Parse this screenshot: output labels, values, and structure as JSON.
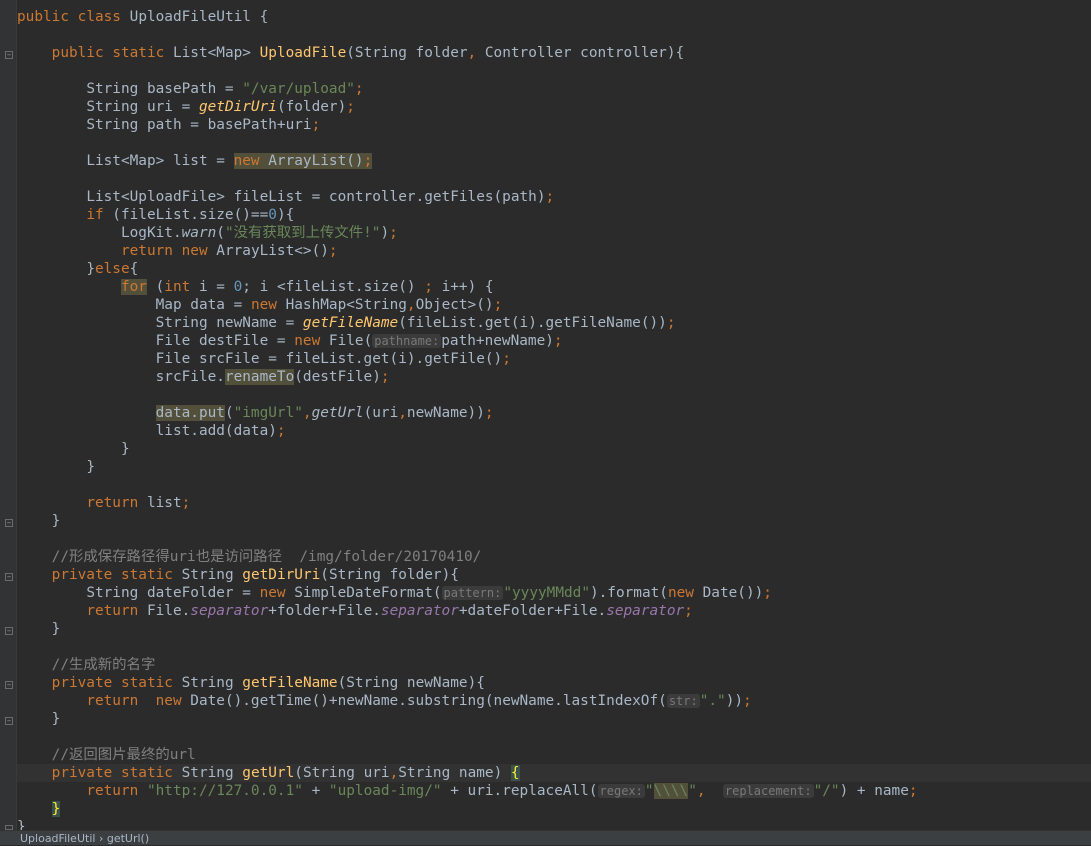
{
  "statusbar": {
    "class_crumb": "UploadFileUtil",
    "sep": "›",
    "method_crumb": "getUrl()"
  },
  "code": {
    "l1": [
      "public",
      "class",
      "UploadFileUtil {"
    ],
    "l3": [
      "public",
      "static",
      "List<Map> ",
      "UploadFile",
      "(String folder",
      ",",
      " Controller controller){"
    ],
    "l5": [
      "String basePath = ",
      "\"/var/upload\"",
      ";"
    ],
    "l6": [
      "String uri = ",
      "getDirUri",
      "(folder)",
      ";"
    ],
    "l7": [
      "String path = basePath+uri",
      ";"
    ],
    "l9": [
      "List<Map> list = ",
      "new",
      " ArrayList()",
      ";"
    ],
    "l11": [
      "List<UploadFile> fileList = controller.getFiles(path)",
      ";"
    ],
    "l12": [
      "if",
      " (fileList.size()==",
      "0",
      "){"
    ],
    "l13": [
      "LogKit.",
      "warn",
      "(",
      "\"没有获取到上传文件!\"",
      ")",
      ";"
    ],
    "l14": [
      "return",
      "new",
      " ArrayList<>()",
      ";"
    ],
    "l15": [
      "}",
      "else",
      "{"
    ],
    "l16": [
      "for",
      " (",
      "int",
      " i = ",
      "0",
      "; i <fileList.size() ",
      "; ",
      "i++) {"
    ],
    "l17": [
      "Map data = ",
      "new",
      " HashMap<String",
      ",",
      "Object>()",
      ";"
    ],
    "l18": [
      "String newName = ",
      "getFileName",
      "(fileList.get(i).getFileName())",
      ";"
    ],
    "l19": [
      "File destFile = ",
      "new",
      " File(",
      "pathname:",
      "path+newName)",
      ";"
    ],
    "l20": [
      "File srcFile = fileList.get(i).getFile()",
      ";"
    ],
    "l21": [
      "srcFile.",
      "renameTo",
      "(destFile)",
      ";"
    ],
    "l23": [
      "data.put",
      "(",
      "\"imgUrl\"",
      ",",
      "getUrl",
      "(uri",
      ",",
      "newName))",
      ";"
    ],
    "l24": [
      "list.add(data)",
      ";"
    ],
    "l25": [
      "}"
    ],
    "l26": [
      "}"
    ],
    "l28": [
      "return",
      " list",
      ";"
    ],
    "l29": [
      "}"
    ],
    "l31": [
      "//形成保存路径得uri也是访问路径  /img/folder/20170410/"
    ],
    "l32": [
      "private",
      "static",
      "String ",
      "getDirUri",
      "(String folder){"
    ],
    "l33": [
      "String dateFolder = ",
      "new",
      " SimpleDateFormat(",
      "pattern:",
      "\"yyyyMMdd\"",
      ").format(",
      "new",
      " Date())",
      ";"
    ],
    "l34": [
      "return",
      " File.",
      "separator",
      "+folder+File.",
      "separator",
      "+dateFolder+File.",
      "separator",
      ";"
    ],
    "l35": [
      "}"
    ],
    "l37": [
      "//生成新的名字"
    ],
    "l38": [
      "private",
      "static",
      "String ",
      "getFileName",
      "(String newName){"
    ],
    "l39": [
      "return",
      "new",
      " Date().getTime()+newName.substring(newName.lastIndexOf(",
      "str:",
      "\".\"",
      "))",
      ";"
    ],
    "l40": [
      "}"
    ],
    "l42": [
      "//返回图片最终的url"
    ],
    "l43": [
      "private",
      "static",
      "String ",
      "getUrl",
      "(String uri",
      ",",
      "String name) ",
      "{"
    ],
    "l44": [
      "return",
      "\"http://127.0.0.1\"",
      " + ",
      "\"upload-img/\"",
      " + uri.replaceAll(",
      "regex:",
      "\"",
      "\\\\\\\\",
      "\"",
      ",",
      "replacement:",
      "\"/\"",
      ") + name",
      ";"
    ],
    "l45": [
      "}"
    ],
    "l46": [
      "}"
    ]
  }
}
